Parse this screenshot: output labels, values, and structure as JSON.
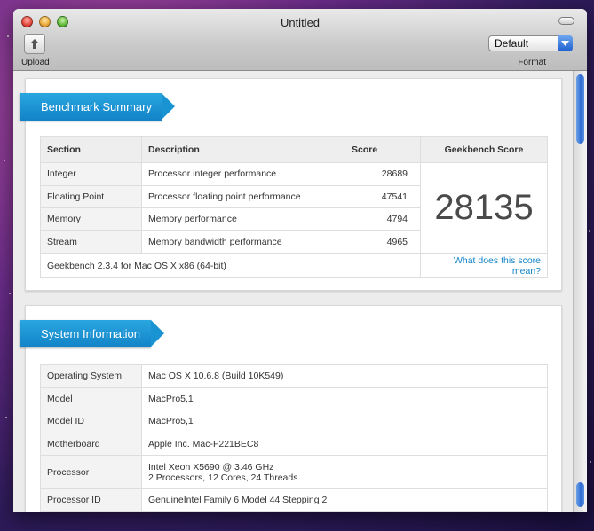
{
  "window": {
    "title": "Untitled"
  },
  "toolbar": {
    "upload_label": "Upload",
    "format_label": "Format",
    "format_value": "Default"
  },
  "benchmark": {
    "heading": "Benchmark Summary",
    "columns": [
      "Section",
      "Description",
      "Score",
      "Geekbench Score"
    ],
    "rows": [
      {
        "section": "Integer",
        "description": "Processor integer performance",
        "score": "28689"
      },
      {
        "section": "Floating Point",
        "description": "Processor floating point performance",
        "score": "47541"
      },
      {
        "section": "Memory",
        "description": "Memory performance",
        "score": "4794"
      },
      {
        "section": "Stream",
        "description": "Memory bandwidth performance",
        "score": "4965"
      }
    ],
    "geekbench_score": "28135",
    "footer_version": "Geekbench 2.3.4 for Mac OS X x86 (64-bit)",
    "footer_link": "What does this score mean?"
  },
  "system": {
    "heading": "System Information",
    "rows": [
      {
        "label": "Operating System",
        "value": "Mac OS X 10.6.8 (Build 10K549)"
      },
      {
        "label": "Model",
        "value": "MacPro5,1"
      },
      {
        "label": "Model ID",
        "value": "MacPro5,1"
      },
      {
        "label": "Motherboard",
        "value": "Apple Inc. Mac-F221BEC8"
      },
      {
        "label": "Processor",
        "value": "Intel Xeon X5690 @ 3.46 GHz",
        "value2": "2 Processors, 12 Cores, 24 Threads"
      },
      {
        "label": "Processor ID",
        "value": "GenuineIntel Family 6 Model 44 Stepping 2"
      }
    ]
  },
  "colors": {
    "accent": "#1283c7",
    "ribbon": "#2aa6e0"
  },
  "icons": {
    "upload": "upload-arrow-icon",
    "dropdown": "chevron-down-icon"
  }
}
